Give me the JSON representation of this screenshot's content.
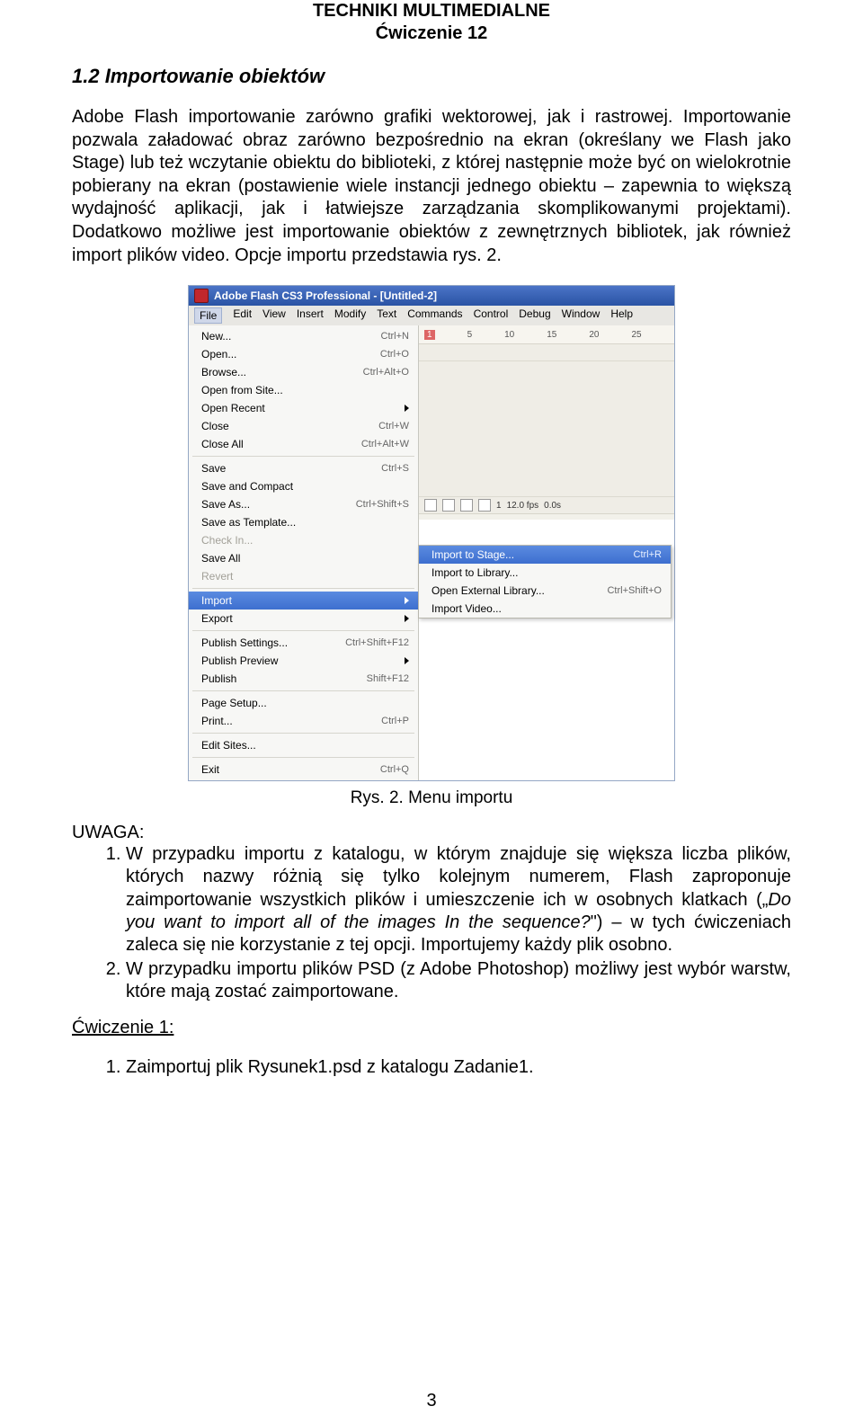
{
  "header": {
    "line1": "TECHNIKI MULTIMEDIALNE",
    "line2": "Ćwiczenie 12"
  },
  "section_title": "1.2 Importowanie obiektów",
  "paragraph": "Adobe Flash importowanie zarówno grafiki wektorowej, jak i rastrowej. Importowanie pozwala załadować obraz zarówno bezpośrednio na ekran (określany we Flash jako Stage) lub też wczytanie obiektu do biblioteki, z której następnie może być on wielokrotnie pobierany na ekran (postawienie wiele instancji jednego obiektu – zapewnia to większą wydajność aplikacji, jak i łatwiejsze zarządzania skomplikowanymi projektami). Dodatkowo możliwe jest importowanie obiektów z zewnętrznych bibliotek, jak również import plików video. Opcje importu przedstawia rys. 2.",
  "caption": "Rys. 2. Menu importu",
  "uwaga": {
    "label": "UWAGA:",
    "items": [
      "W przypadku importu z katalogu, w którym znajduje się większa liczba plików, których nazwy różnią się tylko kolejnym numerem, Flash zaproponuje zaimportowanie wszystkich plików i umieszczenie ich w osobnych klatkach („<i>Do you want to import all of the images In the sequence?</i>\") – w tych ćwiczeniach zaleca się nie korzystanie z tej opcji. Importujemy każdy plik osobno.",
      "W przypadku importu plików PSD (z Adobe Photoshop) możliwy jest wybór warstw, które mają zostać zaimportowane."
    ]
  },
  "exercise": {
    "label": "Ćwiczenie 1:",
    "item": "Zaimportuj plik Rysunek1.psd z katalogu Zadanie1."
  },
  "page_number": "3",
  "screenshot": {
    "title": "Adobe Flash CS3 Professional - [Untitled-2]",
    "menubar": [
      "File",
      "Edit",
      "View",
      "Insert",
      "Modify",
      "Text",
      "Commands",
      "Control",
      "Debug",
      "Window",
      "Help"
    ],
    "ruler": [
      "1",
      "5",
      "10",
      "15",
      "20",
      "25"
    ],
    "timeline": {
      "frame": "1",
      "fps": "12.0 fps",
      "time": "0.0s"
    },
    "file_menu": [
      {
        "label": "New...",
        "shortcut": "Ctrl+N"
      },
      {
        "label": "Open...",
        "shortcut": "Ctrl+O"
      },
      {
        "label": "Browse...",
        "shortcut": "Ctrl+Alt+O"
      },
      {
        "label": "Open from Site..."
      },
      {
        "label": "Open Recent",
        "arrow": true
      },
      {
        "label": "Close",
        "shortcut": "Ctrl+W"
      },
      {
        "label": "Close All",
        "shortcut": "Ctrl+Alt+W"
      },
      {
        "sep": true
      },
      {
        "label": "Save",
        "shortcut": "Ctrl+S"
      },
      {
        "label": "Save and Compact"
      },
      {
        "label": "Save As...",
        "shortcut": "Ctrl+Shift+S"
      },
      {
        "label": "Save as Template..."
      },
      {
        "label": "Check In...",
        "disabled": true
      },
      {
        "label": "Save All"
      },
      {
        "label": "Revert",
        "disabled": true
      },
      {
        "sep": true
      },
      {
        "label": "Import",
        "arrow": true,
        "selected": true
      },
      {
        "label": "Export",
        "arrow": true
      },
      {
        "sep": true
      },
      {
        "label": "Publish Settings...",
        "shortcut": "Ctrl+Shift+F12"
      },
      {
        "label": "Publish Preview",
        "arrow": true
      },
      {
        "label": "Publish",
        "shortcut": "Shift+F12"
      },
      {
        "sep": true
      },
      {
        "label": "Page Setup..."
      },
      {
        "label": "Print...",
        "shortcut": "Ctrl+P"
      },
      {
        "sep": true
      },
      {
        "label": "Edit Sites..."
      },
      {
        "sep": true
      },
      {
        "label": "Exit",
        "shortcut": "Ctrl+Q"
      }
    ],
    "import_submenu": [
      {
        "label": "Import to Stage...",
        "shortcut": "Ctrl+R",
        "selected": true
      },
      {
        "label": "Import to Library..."
      },
      {
        "label": "Open External Library...",
        "shortcut": "Ctrl+Shift+O"
      },
      {
        "label": "Import Video..."
      }
    ]
  }
}
